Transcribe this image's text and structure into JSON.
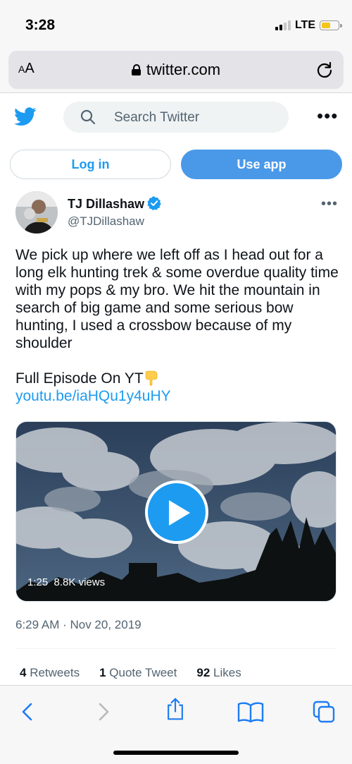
{
  "status_bar": {
    "time": "3:28",
    "network": "LTE"
  },
  "browser": {
    "aa_label": "AA",
    "url": "twitter.com"
  },
  "header": {
    "search_placeholder": "Search Twitter"
  },
  "auth": {
    "login_label": "Log in",
    "use_app_label": "Use app"
  },
  "tweet": {
    "author_name": "TJ Dillashaw",
    "author_handle": "@TJDillashaw",
    "text": "We pick up where we left off as I head out for a long elk hunting trek & some overdue quality time with my pops & my bro. We hit the mountain in search of big game and some serious bow hunting, I used a crossbow because of my shoulder",
    "cta": "Full Episode On YT",
    "link": "youtu.be/iaHQu1y4uHY",
    "media": {
      "duration": "1:25",
      "views": "8.8K views"
    },
    "timestamp": "6:29 AM · Nov 20, 2019",
    "stats": {
      "retweets_count": "4",
      "retweets_label": "Retweets",
      "quotes_count": "1",
      "quotes_label": "Quote Tweet",
      "likes_count": "92",
      "likes_label": "Likes"
    }
  },
  "colors": {
    "accent": "#1d9bf0",
    "use_app_bg": "#4a99e9",
    "muted_text": "#536471"
  },
  "icons": [
    "twitter-bird-icon",
    "search-icon",
    "more-icon",
    "lock-icon",
    "reload-icon",
    "verified-icon",
    "play-icon",
    "back-icon",
    "forward-icon",
    "share-icon",
    "bookmarks-icon",
    "tabs-icon"
  ]
}
